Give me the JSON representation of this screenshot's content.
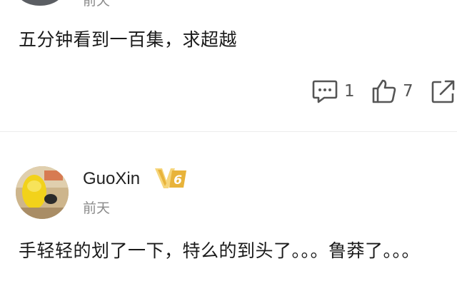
{
  "comments": [
    {
      "time": "前天",
      "text": "五分钟看到一百集，求超越",
      "reply_count": "1",
      "like_count": "7"
    },
    {
      "username": "GuoXin",
      "badge": "V6",
      "time": "前天",
      "text": "手轻轻的划了一下，特么的到头了。。。鲁莽了。。。"
    }
  ],
  "colors": {
    "icon": "#555555",
    "badge_gold": "#e8b33a",
    "badge_light": "#f6d57a",
    "muted_text": "#8a8a8a"
  },
  "icons": {
    "reply": "comment-icon",
    "like": "thumbs-up-icon",
    "share": "share-icon",
    "badge": "vip-badge-icon"
  }
}
